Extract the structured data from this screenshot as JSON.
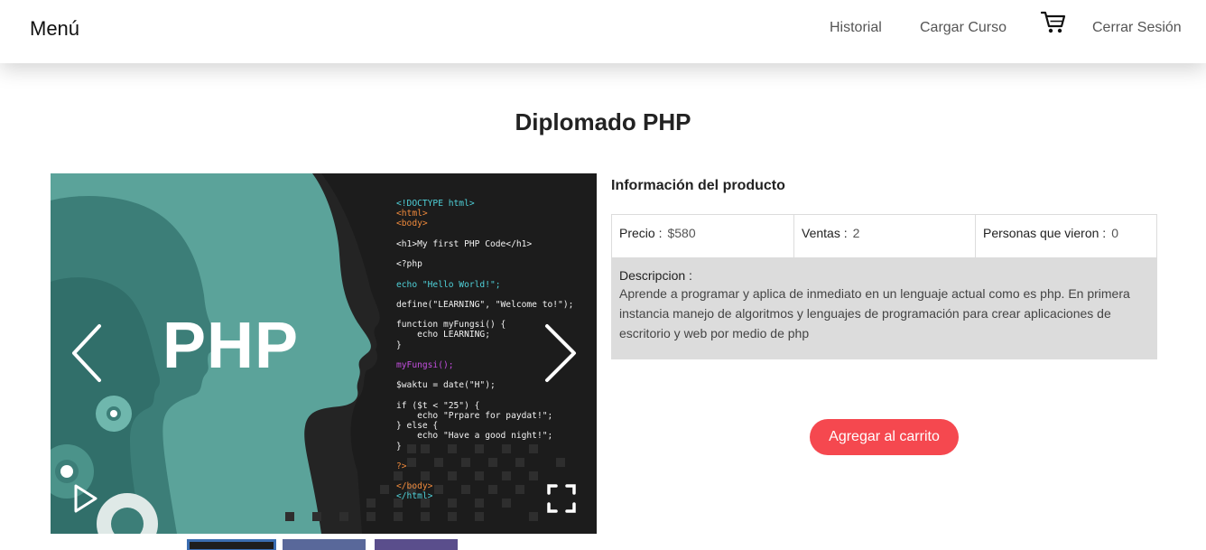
{
  "navbar": {
    "brand": "Menú",
    "links": {
      "historial": "Historial",
      "cargar": "Cargar Curso",
      "logout": "Cerrar Sesión"
    },
    "cart_icon": "shopping-cart-icon"
  },
  "page": {
    "title": "Diplomado PHP"
  },
  "carousel": {
    "slide_text": "PHP",
    "code": [
      {
        "t": "<!DOCTYPE html>",
        "c": "#4fd1d9"
      },
      {
        "t": "<html>",
        "c": "#f08a3c"
      },
      {
        "t": "<body>",
        "c": "#f08a3c"
      },
      {
        "t": "",
        "c": "#f2f2f2"
      },
      {
        "t": "<h1>My first PHP Code</h1>",
        "c": "#f2f2f2"
      },
      {
        "t": "",
        "c": "#f2f2f2"
      },
      {
        "t": "<?php",
        "c": "#f2f2f2"
      },
      {
        "t": "",
        "c": "#f2f2f2"
      },
      {
        "t": "echo \"Hello World!\";",
        "c": "#4fd1d9"
      },
      {
        "t": "",
        "c": "#f2f2f2"
      },
      {
        "t": "define(\"LEARNING\", \"Welcome to!\");",
        "c": "#f2f2f2"
      },
      {
        "t": "",
        "c": "#f2f2f2"
      },
      {
        "t": "function myFungsi() {",
        "c": "#f2f2f2"
      },
      {
        "t": "    echo LEARNING;",
        "c": "#f2f2f2"
      },
      {
        "t": "}",
        "c": "#f2f2f2"
      },
      {
        "t": "",
        "c": "#f2f2f2"
      },
      {
        "t": "myFungsi();",
        "c": "#c44fe0"
      },
      {
        "t": "",
        "c": "#f2f2f2"
      },
      {
        "t": "$waktu = date(\"H\");",
        "c": "#f2f2f2"
      },
      {
        "t": "",
        "c": "#f2f2f2"
      },
      {
        "t": "if ($t < \"25\") {",
        "c": "#f2f2f2"
      },
      {
        "t": "    echo \"Prpare for paydat!\";",
        "c": "#f2f2f2"
      },
      {
        "t": "} else {",
        "c": "#f2f2f2"
      },
      {
        "t": "    echo \"Have a good night!\";",
        "c": "#f2f2f2"
      },
      {
        "t": "}",
        "c": "#f2f2f2"
      },
      {
        "t": "",
        "c": "#f2f2f2"
      },
      {
        "t": "?>",
        "c": "#f08a3c"
      },
      {
        "t": "",
        "c": "#f2f2f2"
      },
      {
        "t": "</body>",
        "c": "#f08a3c"
      },
      {
        "t": "</html>",
        "c": "#4fd1d9"
      }
    ]
  },
  "product": {
    "heading": "Información del producto",
    "price_label": "Precio :",
    "price_value": "$580",
    "sales_label": "Ventas :",
    "sales_value": "2",
    "views_label": "Personas que vieron :",
    "views_value": "0",
    "description_label": "Descripcion :",
    "description": "Aprende a programar y aplica de inmediato en un lenguaje actual como es php. En primera instancia manejo de algoritmos y lenguajes de programación para crear aplicaciones de escritorio y web por medio de php"
  },
  "actions": {
    "add_to_cart": "Agregar al carrito"
  },
  "colors": {
    "accent": "#f5484f",
    "teal": "#5ba39a",
    "dark": "#1c1c1c"
  }
}
